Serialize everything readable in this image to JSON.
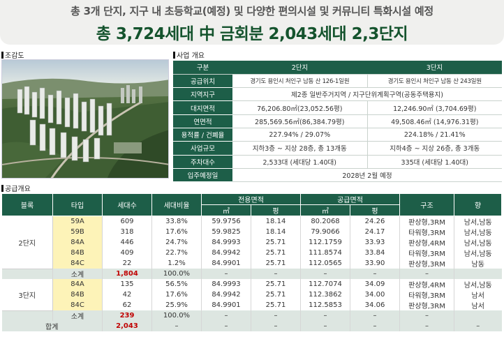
{
  "header": {
    "line1": "총 3개 단지, 지구 내 초등학교(예정) 및 다양한 편의시설 및 커뮤니티 특화시설 예정",
    "line2": "총 3,724세대 中 금회분 2,043세대 2,3단지"
  },
  "sections": {
    "birdseye": "조감도",
    "overview": "사업 개요",
    "supply": "공급개요"
  },
  "overview": {
    "headers": [
      "구분",
      "2단지",
      "3단지"
    ],
    "rows": [
      {
        "label": "공급위치",
        "v1": "경기도 용인시 처인구 남동 산 126-1일원",
        "v2": "경기도 용인시 처인구 남동 산 243일원"
      },
      {
        "label": "지역지구",
        "span": "제2종 일반주거지역 / 지구단위계획구역(공동주택용지)"
      },
      {
        "label": "대지면적",
        "v1": "76,206.80㎡(23,052.56평)",
        "v2": "12,246.90㎡ (3,704.69평)"
      },
      {
        "label": "연면적",
        "v1": "285,569.56㎡(86,384.79평)",
        "v2": "49,508.46㎡ (14,976.31평)"
      },
      {
        "label": "용적률 / 건폐율",
        "v1": "227.94% / 29.07%",
        "v2": "224.18% / 21.41%"
      },
      {
        "label": "사업규모",
        "v1": "지하3층 ~ 지상 28층, 총 13개동",
        "v2": "지하4층 ~ 지상 26층, 총 3개동"
      },
      {
        "label": "주차대수",
        "v1": "2,533대 (세대당 1.40대)",
        "v2": "335대 (세대당 1.40대)"
      },
      {
        "label": "입주예정일",
        "span": "2028년 2월 예정"
      }
    ]
  },
  "supply": {
    "headers": {
      "block": "블록",
      "type": "타입",
      "units": "세대수",
      "ratio": "세대비율",
      "exclusive": "전용면적",
      "supply_area": "공급면적",
      "sqm": "㎡",
      "pyeong": "평",
      "structure": "구조",
      "direction": "향"
    },
    "blocks": [
      {
        "name": "2단지",
        "rows": [
          {
            "type": "59A",
            "units": "609",
            "ratio": "33.8%",
            "ex_m2": "59.9756",
            "ex_py": "18.14",
            "sp_m2": "80.2068",
            "sp_py": "24.26",
            "structure": "판상형,3RM",
            "direction": "남서,남동"
          },
          {
            "type": "59B",
            "units": "318",
            "ratio": "17.6%",
            "ex_m2": "59.9825",
            "ex_py": "18.14",
            "sp_m2": "79.9066",
            "sp_py": "24.17",
            "structure": "타워형,3RM",
            "direction": "남서,남동"
          },
          {
            "type": "84A",
            "units": "446",
            "ratio": "24.7%",
            "ex_m2": "84.9993",
            "ex_py": "25.71",
            "sp_m2": "112.1759",
            "sp_py": "33.93",
            "structure": "판상형,4RM",
            "direction": "남서,남동"
          },
          {
            "type": "84B",
            "units": "409",
            "ratio": "22.7%",
            "ex_m2": "84.9942",
            "ex_py": "25.71",
            "sp_m2": "111.8574",
            "sp_py": "33.84",
            "structure": "타워형,3RM",
            "direction": "남서,남동"
          },
          {
            "type": "84C",
            "units": "22",
            "ratio": "1.2%",
            "ex_m2": "84.9901",
            "ex_py": "25.71",
            "sp_m2": "112.0565",
            "sp_py": "33.90",
            "structure": "판상형,3RM",
            "direction": "남동"
          }
        ],
        "subtotal": {
          "label": "소계",
          "units": "1,804",
          "ratio": "100.0%",
          "dash": "–"
        }
      },
      {
        "name": "3단지",
        "rows": [
          {
            "type": "84A",
            "units": "135",
            "ratio": "56.5%",
            "ex_m2": "84.9993",
            "ex_py": "25.71",
            "sp_m2": "112.7074",
            "sp_py": "34.09",
            "structure": "판상형,4RM",
            "direction": "남서,남동"
          },
          {
            "type": "84B",
            "units": "42",
            "ratio": "17.6%",
            "ex_m2": "84.9942",
            "ex_py": "25.71",
            "sp_m2": "112.3862",
            "sp_py": "34.00",
            "structure": "타워형,3RM",
            "direction": "남서"
          },
          {
            "type": "84C",
            "units": "62",
            "ratio": "25.9%",
            "ex_m2": "84.9901",
            "ex_py": "25.71",
            "sp_m2": "112.5853",
            "sp_py": "34.06",
            "structure": "판상형,3RM",
            "direction": "남서"
          }
        ],
        "subtotal": {
          "label": "소계",
          "units": "239",
          "ratio": "100.0%",
          "dash": "–"
        }
      }
    ],
    "total": {
      "label": "합계",
      "units": "2,043",
      "dash": "–"
    }
  }
}
